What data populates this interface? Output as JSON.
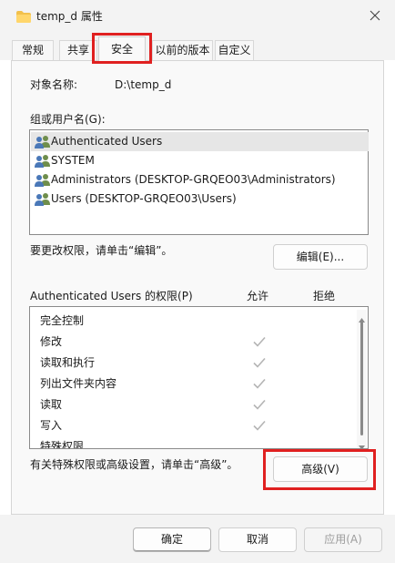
{
  "window": {
    "title": "temp_d 属性",
    "folder_icon": "folder-icon",
    "close_icon": "close-icon"
  },
  "tabs": [
    {
      "label": "常规",
      "active": false
    },
    {
      "label": "共享",
      "active": false
    },
    {
      "label": "安全",
      "active": true
    },
    {
      "label": "以前的版本",
      "active": false
    },
    {
      "label": "自定义",
      "active": false
    }
  ],
  "security": {
    "object_label": "对象名称:",
    "object_value": "D:\\temp_d",
    "group_label": "组或用户名(G):",
    "users": [
      {
        "name": "Authenticated Users",
        "selected": true
      },
      {
        "name": "SYSTEM",
        "selected": false
      },
      {
        "name": "Administrators (DESKTOP-GRQEO03\\Administrators)",
        "selected": false
      },
      {
        "name": "Users (DESKTOP-GRQEO03\\Users)",
        "selected": false
      }
    ],
    "edit_hint": "要更改权限，请单击“编辑”。",
    "edit_button": "编辑(E)...",
    "perm_label": "Authenticated Users 的权限(P)",
    "allow_header": "允许",
    "deny_header": "拒绝",
    "permissions": [
      {
        "name": "完全控制",
        "allow": false
      },
      {
        "name": "修改",
        "allow": true
      },
      {
        "name": "读取和执行",
        "allow": true
      },
      {
        "name": "列出文件夹内容",
        "allow": true
      },
      {
        "name": "读取",
        "allow": true
      },
      {
        "name": "写入",
        "allow": true
      },
      {
        "name": "特殊权限",
        "allow": false
      }
    ],
    "advanced_hint": "有关特殊权限或高级设置，请单击“高级”。",
    "advanced_button": "高级(V)"
  },
  "footer": {
    "ok": "确定",
    "cancel": "取消",
    "apply": "应用(A)"
  },
  "colors": {
    "highlight": "#e02020",
    "check": "#b4b4b4",
    "selection": "#e6e6e6"
  }
}
